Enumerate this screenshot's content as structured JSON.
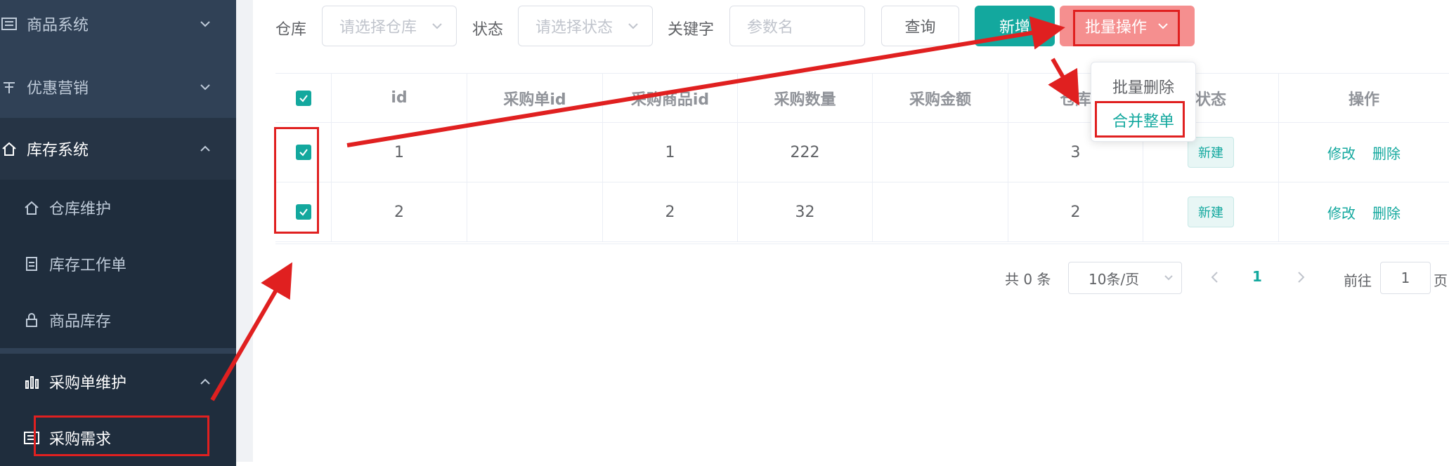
{
  "sidebar": {
    "items": [
      {
        "label": "商品系统",
        "icon": "list-icon"
      },
      {
        "label": "优惠营销",
        "icon": "gift-icon"
      },
      {
        "label": "库存系统",
        "icon": "home-icon"
      },
      {
        "label": "仓库维护",
        "icon": "home-icon"
      },
      {
        "label": "库存工作单",
        "icon": "document-icon"
      },
      {
        "label": "商品库存",
        "icon": "lock-icon"
      },
      {
        "label": "采购单维护",
        "icon": "bar-chart-icon"
      },
      {
        "label": "采购需求",
        "icon": "list-icon"
      }
    ]
  },
  "filters": {
    "warehouse_label": "仓库",
    "warehouse_placeholder": "请选择仓库",
    "status_label": "状态",
    "status_placeholder": "请选择状态",
    "keyword_label": "关键字",
    "keyword_placeholder": "参数名",
    "query_button": "查询",
    "add_button": "新增",
    "batch_button": "批量操作"
  },
  "dropdown": {
    "items": [
      "批量删除",
      "合并整单"
    ]
  },
  "table": {
    "columns": [
      "id",
      "采购单id",
      "采购商品id",
      "采购数量",
      "采购金额",
      "仓库",
      "状态",
      "操作"
    ],
    "rows": [
      {
        "id": "1",
        "purchase_id": "",
        "sku_id": "1",
        "quantity": "222",
        "amount": "",
        "warehouse": "3",
        "status": "新建",
        "edit": "修改",
        "delete": "删除"
      },
      {
        "id": "2",
        "purchase_id": "",
        "sku_id": "2",
        "quantity": "32",
        "amount": "",
        "warehouse": "2",
        "status": "新建",
        "edit": "修改",
        "delete": "删除"
      }
    ]
  },
  "pagination": {
    "total_text": "共 0 条",
    "page_size": "10条/页",
    "current_page": "1",
    "goto_label": "前往",
    "goto_value": "1",
    "page_suffix": "页"
  },
  "colors": {
    "primary": "#13a89e",
    "danger_button": "#f58f8f",
    "annotation": "#e02020",
    "sidebar_bg": "#304156"
  }
}
